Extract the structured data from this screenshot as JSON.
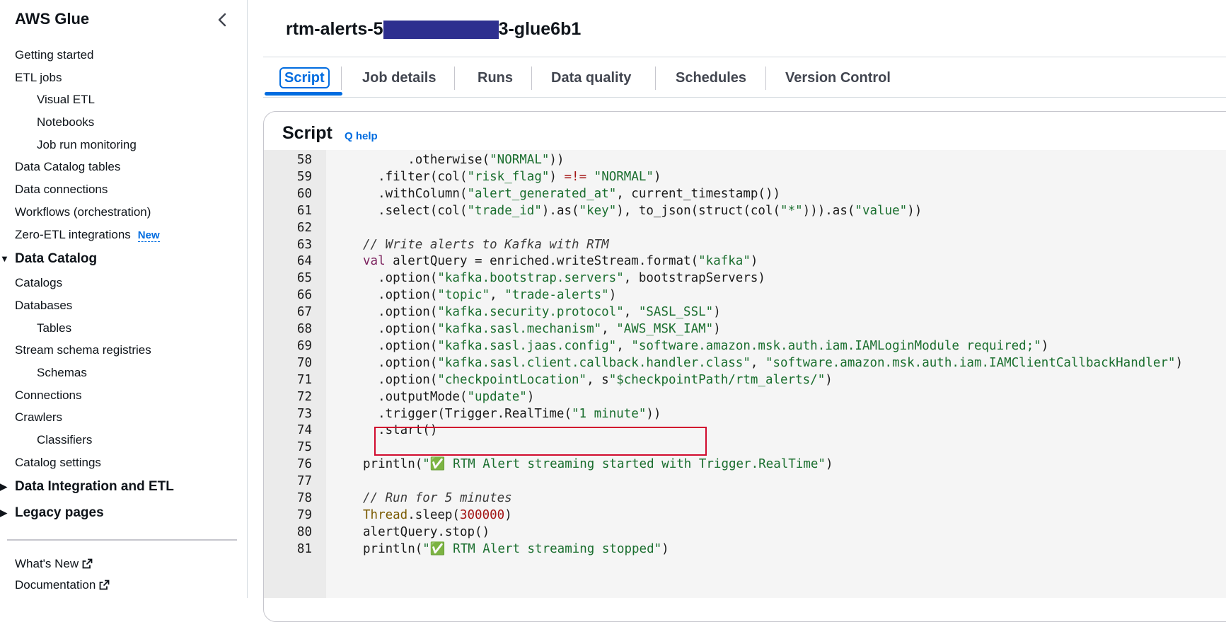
{
  "sidebar": {
    "title": "AWS Glue",
    "items": [
      {
        "label": "Getting started",
        "level": 0
      },
      {
        "label": "ETL jobs",
        "level": 0
      },
      {
        "label": "Visual ETL",
        "level": 1
      },
      {
        "label": "Notebooks",
        "level": 1
      },
      {
        "label": "Job run monitoring",
        "level": 1
      },
      {
        "label": "Data Catalog tables",
        "level": 0
      },
      {
        "label": "Data connections",
        "level": 0
      },
      {
        "label": "Workflows (orchestration)",
        "level": 0
      },
      {
        "label": "Zero-ETL integrations",
        "level": 0,
        "badge": "New"
      },
      {
        "label": "Data Catalog",
        "level": "section",
        "expanded": true
      },
      {
        "label": "Catalogs",
        "level": 0
      },
      {
        "label": "Databases",
        "level": 0
      },
      {
        "label": "Tables",
        "level": 1
      },
      {
        "label": "Stream schema registries",
        "level": 0
      },
      {
        "label": "Schemas",
        "level": 1
      },
      {
        "label": "Connections",
        "level": 0
      },
      {
        "label": "Crawlers",
        "level": 0
      },
      {
        "label": "Classifiers",
        "level": 1
      },
      {
        "label": "Catalog settings",
        "level": 0
      },
      {
        "label": "Data Integration and ETL",
        "level": "section",
        "expanded": false
      },
      {
        "label": "Legacy pages",
        "level": "section",
        "expanded": false
      }
    ],
    "footer": [
      "What's New",
      "Documentation"
    ]
  },
  "job": {
    "title_prefix": "rtm-alerts-5",
    "title_suffix": "3-glue6b1"
  },
  "tabs": [
    "Script",
    "Job details",
    "Runs",
    "Data quality",
    "Schedules",
    "Version Control"
  ],
  "active_tab": "Script",
  "script_panel": {
    "title": "Script",
    "help_link": "Q help",
    "lines": [
      {
        "n": "58",
        "tokens": [
          [
            "      .otherwise(",
            "p"
          ],
          [
            "\"NORMAL\"",
            "s"
          ],
          [
            "))",
            "p"
          ]
        ]
      },
      {
        "n": "59",
        "tokens": [
          [
            "  .filter(col(",
            "p"
          ],
          [
            "\"risk_flag\"",
            "s"
          ],
          [
            ") ",
            "p"
          ],
          [
            "=!=",
            "o"
          ],
          [
            " ",
            "p"
          ],
          [
            "\"NORMAL\"",
            "s"
          ],
          [
            ")",
            "p"
          ]
        ]
      },
      {
        "n": "60",
        "tokens": [
          [
            "  .withColumn(",
            "p"
          ],
          [
            "\"alert_generated_at\"",
            "s"
          ],
          [
            ", current_timestamp())",
            "p"
          ]
        ]
      },
      {
        "n": "61",
        "tokens": [
          [
            "  .select(col(",
            "p"
          ],
          [
            "\"trade_id\"",
            "s"
          ],
          [
            ").as(",
            "p"
          ],
          [
            "\"key\"",
            "s"
          ],
          [
            "), to_json(struct(col(",
            "p"
          ],
          [
            "\"*\"",
            "s"
          ],
          [
            "))).as(",
            "p"
          ],
          [
            "\"value\"",
            "s"
          ],
          [
            "))",
            "p"
          ]
        ]
      },
      {
        "n": "62",
        "tokens": []
      },
      {
        "n": "63",
        "tokens": [
          [
            "// Write alerts to Kafka with RTM",
            "c"
          ]
        ]
      },
      {
        "n": "64",
        "tokens": [
          [
            "val",
            "k"
          ],
          [
            " alertQuery = enriched.writeStream.format(",
            "p"
          ],
          [
            "\"kafka\"",
            "s"
          ],
          [
            ")",
            "p"
          ]
        ]
      },
      {
        "n": "65",
        "tokens": [
          [
            "  .option(",
            "p"
          ],
          [
            "\"kafka.bootstrap.servers\"",
            "s"
          ],
          [
            ", bootstrapServers)",
            "p"
          ]
        ]
      },
      {
        "n": "66",
        "tokens": [
          [
            "  .option(",
            "p"
          ],
          [
            "\"topic\"",
            "s"
          ],
          [
            ", ",
            "p"
          ],
          [
            "\"trade-alerts\"",
            "s"
          ],
          [
            ")",
            "p"
          ]
        ]
      },
      {
        "n": "67",
        "tokens": [
          [
            "  .option(",
            "p"
          ],
          [
            "\"kafka.security.protocol\"",
            "s"
          ],
          [
            ", ",
            "p"
          ],
          [
            "\"SASL_SSL\"",
            "s"
          ],
          [
            ")",
            "p"
          ]
        ]
      },
      {
        "n": "68",
        "tokens": [
          [
            "  .option(",
            "p"
          ],
          [
            "\"kafka.sasl.mechanism\"",
            "s"
          ],
          [
            ", ",
            "p"
          ],
          [
            "\"AWS_MSK_IAM\"",
            "s"
          ],
          [
            ")",
            "p"
          ]
        ]
      },
      {
        "n": "69",
        "tokens": [
          [
            "  .option(",
            "p"
          ],
          [
            "\"kafka.sasl.jaas.config\"",
            "s"
          ],
          [
            ", ",
            "p"
          ],
          [
            "\"software.amazon.msk.auth.iam.IAMLoginModule required;\"",
            "s"
          ],
          [
            ")",
            "p"
          ]
        ]
      },
      {
        "n": "70",
        "tokens": [
          [
            "  .option(",
            "p"
          ],
          [
            "\"kafka.sasl.client.callback.handler.class\"",
            "s"
          ],
          [
            ", ",
            "p"
          ],
          [
            "\"software.amazon.msk.auth.iam.IAMClientCallbackHandler\"",
            "s"
          ],
          [
            ")",
            "p"
          ]
        ]
      },
      {
        "n": "71",
        "tokens": [
          [
            "  .option(",
            "p"
          ],
          [
            "\"checkpointLocation\"",
            "s"
          ],
          [
            ", s",
            "p"
          ],
          [
            "\"$checkpointPath/rtm_alerts/\"",
            "s"
          ],
          [
            ")",
            "p"
          ]
        ]
      },
      {
        "n": "72",
        "tokens": [
          [
            "  .outputMode(",
            "p"
          ],
          [
            "\"update\"",
            "s"
          ],
          [
            ")",
            "p"
          ]
        ]
      },
      {
        "n": "73",
        "tokens": [
          [
            "  .trigger(Trigger.RealTime(",
            "p"
          ],
          [
            "\"1 minute\"",
            "s"
          ],
          [
            "))",
            "p"
          ]
        ]
      },
      {
        "n": "74",
        "tokens": [
          [
            "  .start()",
            "p"
          ]
        ]
      },
      {
        "n": "75",
        "tokens": []
      },
      {
        "n": "76",
        "tokens": [
          [
            "println(",
            "p"
          ],
          [
            "\"✅ RTM Alert streaming started with Trigger.RealTime\"",
            "s"
          ],
          [
            ")",
            "p"
          ]
        ]
      },
      {
        "n": "77",
        "tokens": []
      },
      {
        "n": "78",
        "tokens": [
          [
            "// Run for 5 minutes",
            "c"
          ]
        ]
      },
      {
        "n": "79",
        "tokens": [
          [
            "Thread",
            "t"
          ],
          [
            ".sleep(",
            "p"
          ],
          [
            "300000",
            "o"
          ],
          [
            ")",
            "p"
          ]
        ]
      },
      {
        "n": "80",
        "tokens": [
          [
            "alertQuery.stop()",
            "p"
          ]
        ]
      },
      {
        "n": "81",
        "tokens": [
          [
            "println(",
            "p"
          ],
          [
            "\"✅ RTM Alert streaming stopped\"",
            "s"
          ],
          [
            ")",
            "p"
          ]
        ]
      }
    ]
  },
  "highlighted_line": "73",
  "colors": {
    "accent": "#006ce0",
    "string": "#1a6e2e",
    "keyword": "#7a1f5c",
    "number_operator": "#a31515",
    "type": "#7a5a00",
    "comment": "#3c3c3c",
    "highlight_border": "#d10b2e",
    "redaction": "#2e2f8f"
  }
}
